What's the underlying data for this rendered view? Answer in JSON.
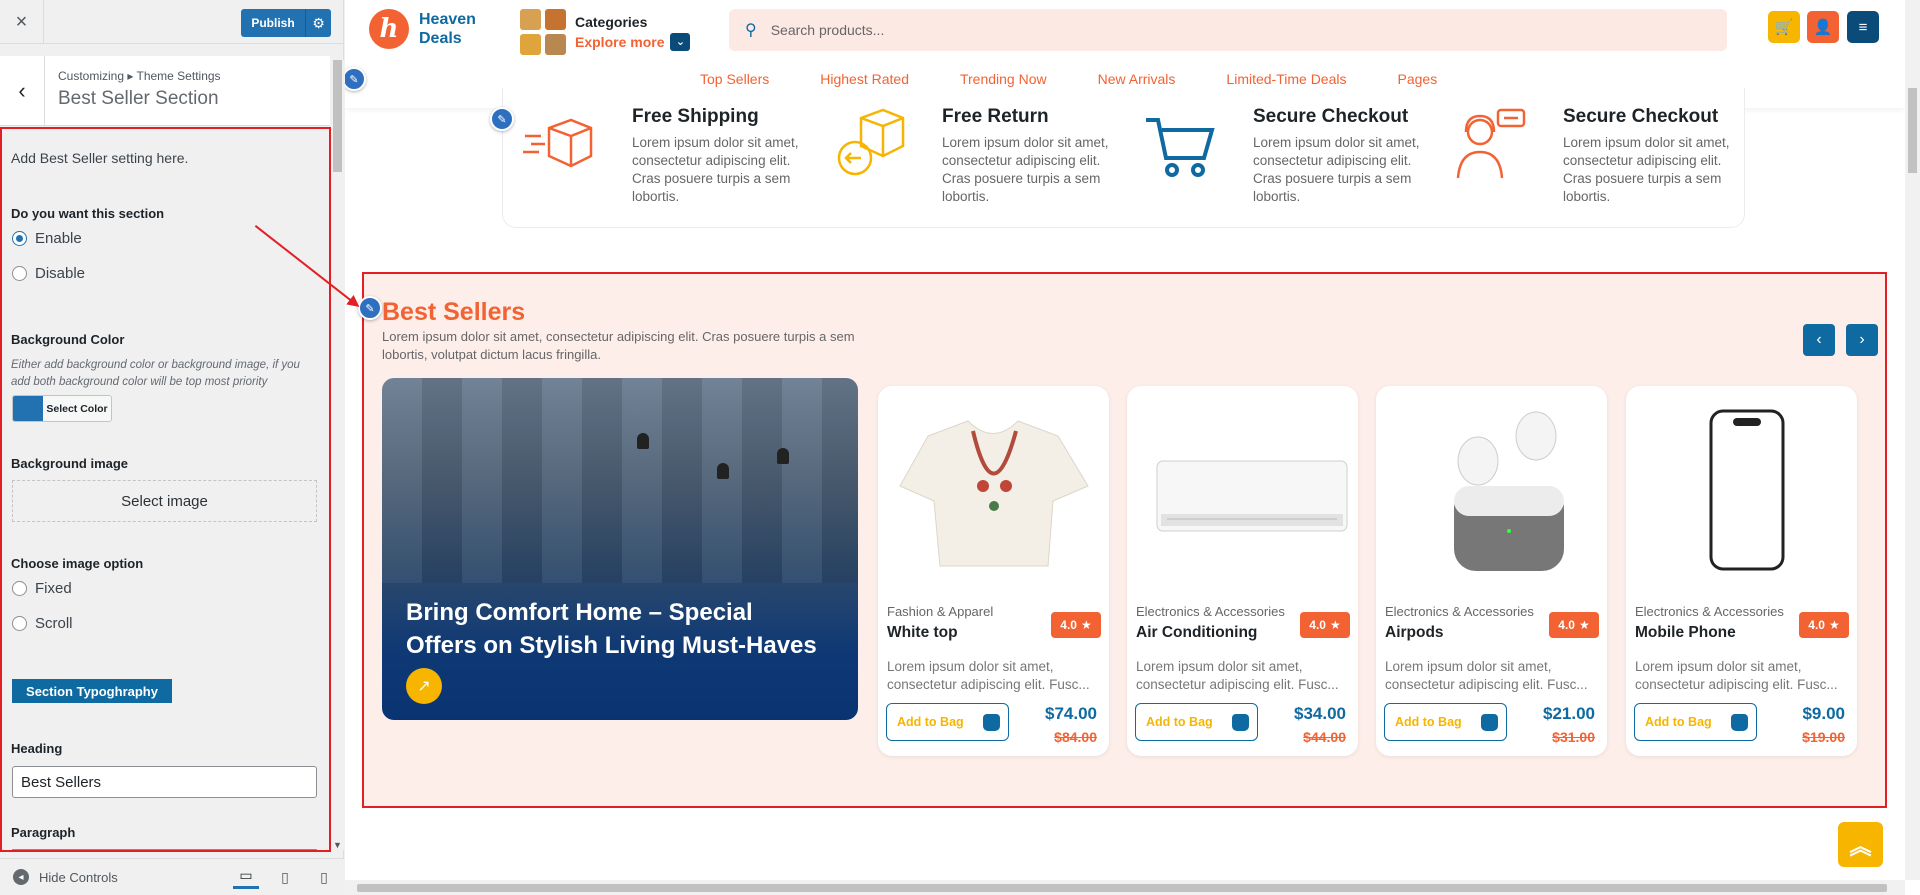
{
  "customizer": {
    "close_label": "×",
    "publish_label": "Publish",
    "breadcrumb": "Customizing ▸ Theme Settings",
    "section_title": "Best Seller Section",
    "description": "Add Best Seller setting here.",
    "show_section": {
      "label": "Do you want this section",
      "options": [
        "Enable",
        "Disable"
      ],
      "selected": "Enable"
    },
    "background_color": {
      "label": "Background Color",
      "help": "Either add background color or background image, if you add both background color will be top most priority",
      "button_label": "Select Color",
      "swatch": "#2271b1"
    },
    "background_image": {
      "label": "Background image",
      "button_label": "Select image"
    },
    "image_option": {
      "label": "Choose image option",
      "options": [
        "Fixed",
        "Scroll"
      ]
    },
    "typography_button": "Section Typoghraphy",
    "heading": {
      "label": "Heading",
      "value": "Best Sellers"
    },
    "paragraph": {
      "label": "Paragraph"
    },
    "footer": {
      "hide_controls": "Hide Controls"
    }
  },
  "site": {
    "logo": {
      "line1": "Heaven",
      "line2": "Deals",
      "mark": "h"
    },
    "categories": {
      "title": "Categories",
      "link": "Explore more"
    },
    "search_placeholder": "Search products...",
    "nav": [
      "Top Sellers",
      "Highest Rated",
      "Trending Now",
      "New Arrivals",
      "Limited-Time Deals",
      "Pages"
    ],
    "features": [
      {
        "title": "Free Shipping",
        "text": "Lorem ipsum dolor sit amet, consectetur adipiscing elit. Cras posuere turpis a sem lobortis.",
        "icon": "shipping-box-icon"
      },
      {
        "title": "Free Return",
        "text": "Lorem ipsum dolor sit amet, consectetur adipiscing elit. Cras posuere turpis a sem lobortis.",
        "icon": "return-box-icon"
      },
      {
        "title": "Secure Checkout",
        "text": "Lorem ipsum dolor sit amet, consectetur adipiscing elit. Cras posuere turpis a sem lobortis.",
        "icon": "cart-icon"
      },
      {
        "title": "Secure Checkout",
        "text": "Lorem ipsum dolor sit amet, consectetur adipiscing elit. Cras posuere turpis a sem lobortis.",
        "icon": "support-agent-icon"
      }
    ],
    "best_sellers": {
      "title": "Best Sellers",
      "description": "Lorem ipsum dolor sit amet, consectetur adipiscing elit. Cras posuere turpis a sem lobortis, volutpat dictum lacus fringilla.",
      "banner_text": "Bring Comfort Home – Special Offers on Stylish Living Must-Haves",
      "products": [
        {
          "category": "Fashion & Apparel",
          "name": "White top",
          "rating": "4.0",
          "desc": "Lorem ipsum dolor sit amet, consectetur adipiscing elit. Fusc...",
          "button": "Add to Bag",
          "price": "$74.00",
          "old_price": "$84.00"
        },
        {
          "category": "Electronics & Accessories",
          "name": "Air Conditioning",
          "rating": "4.0",
          "desc": "Lorem ipsum dolor sit amet, consectetur adipiscing elit. Fusc...",
          "button": "Add to Bag",
          "price": "$34.00",
          "old_price": "$44.00"
        },
        {
          "category": "Electronics & Accessories",
          "name": "Airpods",
          "rating": "4.0",
          "desc": "Lorem ipsum dolor sit amet, consectetur adipiscing elit. Fusc...",
          "button": "Add to Bag",
          "price": "$21.00",
          "old_price": "$31.00"
        },
        {
          "category": "Electronics & Accessories",
          "name": "Mobile Phone",
          "rating": "4.0",
          "desc": "Lorem ipsum dolor sit amet, consectetur adipiscing elit. Fusc...",
          "button": "Add to Bag",
          "price": "$9.00",
          "old_price": "$19.00"
        }
      ]
    },
    "colors": {
      "primary": "#0e6aa0",
      "accent": "#f26232",
      "highlight": "#f7b500",
      "section_bg": "#fdeeea"
    }
  }
}
